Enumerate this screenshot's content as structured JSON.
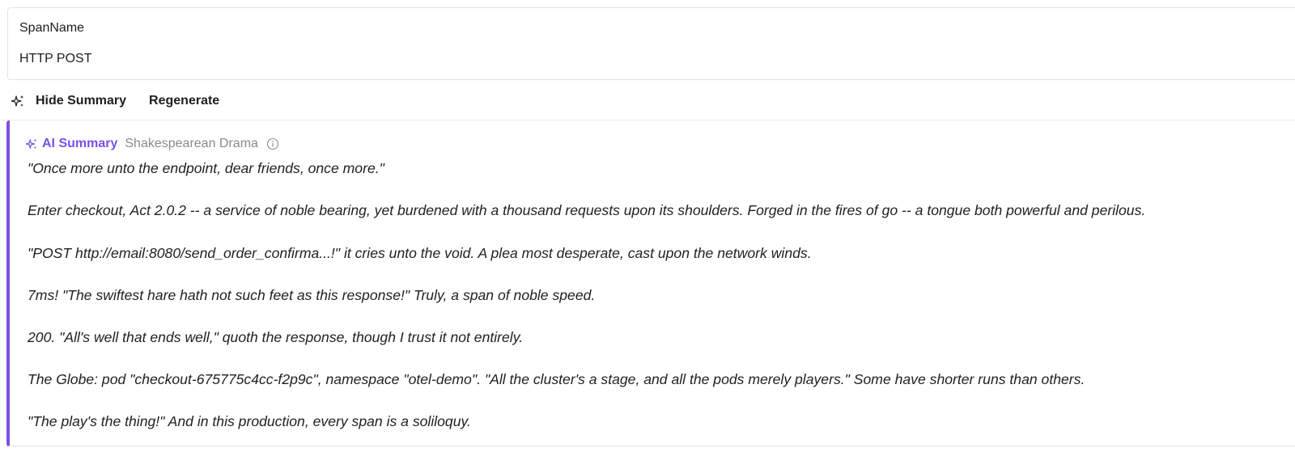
{
  "span": {
    "label": "SpanName",
    "value": "HTTP POST"
  },
  "toolbar": {
    "hide_label": "Hide Summary",
    "regenerate_label": "Regenerate",
    "icon": "sparkle-icon"
  },
  "summary": {
    "title": "AI Summary",
    "style": "Shakespearean Drama",
    "accent_color": "#7b4fe9",
    "paragraphs": [
      "\"Once more unto the endpoint, dear friends, once more.\"",
      "Enter checkout, Act 2.0.2 -- a service of noble bearing, yet burdened with a thousand requests upon its shoulders. Forged in the fires of go -- a tongue both powerful and perilous.",
      "\"POST http://email:8080/send_order_confirma...!\" it cries unto the void. A plea most desperate, cast upon the network winds.",
      "7ms! \"The swiftest hare hath not such feet as this response!\" Truly, a span of noble speed.",
      "200. \"All's well that ends well,\" quoth the response, though I trust it not entirely.",
      "The Globe: pod \"checkout-675775c4cc-f2p9c\", namespace \"otel-demo\". \"All the cluster's a stage, and all the pods merely players.\" Some have shorter runs than others.",
      "\"The play's the thing!\" And in this production, every span is a soliloquy."
    ]
  }
}
